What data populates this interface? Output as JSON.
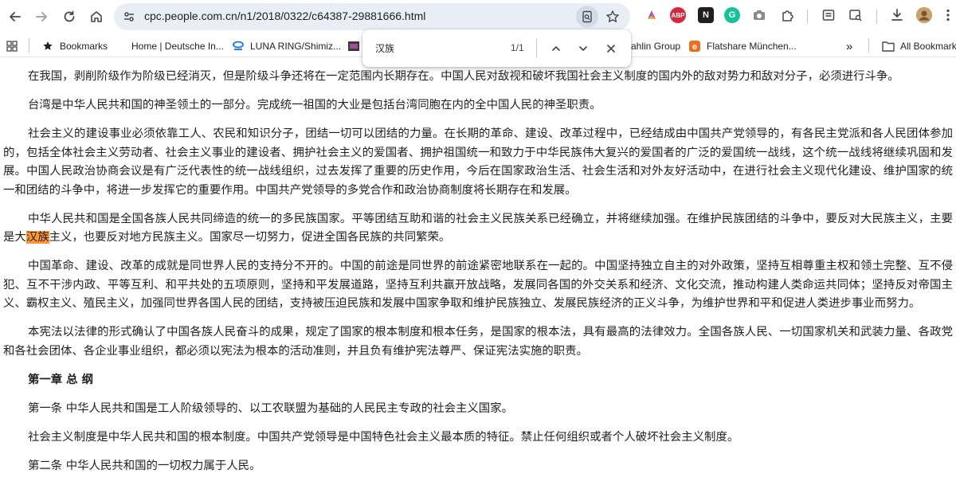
{
  "browser": {
    "url": "cpc.people.com.cn/n1/2018/0322/c64387-29881666.html",
    "extensions": [
      "aurora-icon",
      "abp-icon",
      "notion-icon",
      "grammarly-icon",
      "camera-icon",
      "puzzle-icon"
    ],
    "abp_label": "ABP",
    "notion_label": "N",
    "grammarly_label": "G"
  },
  "bookmarks": {
    "items": [
      {
        "label": "Bookmarks"
      },
      {
        "label": "Home | Deutsche In..."
      },
      {
        "label": "LUNA RING/Shimiz..."
      },
      {
        "label": "ahlin Group"
      },
      {
        "label": "Flatshare München..."
      }
    ],
    "overflow_label": "»",
    "all_bookmarks": "All Bookmarks"
  },
  "find": {
    "query": "汉族",
    "count": "1/1"
  },
  "article": {
    "p1": "在我国，剥削阶级作为阶级已经消灭，但是阶级斗争还将在一定范围内长期存在。中国人民对敌视和破坏我国社会主义制度的国内外的敌对势力和敌对分子，必须进行斗争。",
    "p2": "台湾是中华人民共和国的神圣领土的一部分。完成统一祖国的大业是包括台湾同胞在内的全中国人民的神圣职责。",
    "p3": "社会主义的建设事业必须依靠工人、农民和知识分子，团结一切可以团结的力量。在长期的革命、建设、改革过程中，已经结成由中国共产党领导的，有各民主党派和各人民团体参加的，包括全体社会主义劳动者、社会主义事业的建设者、拥护社会主义的爱国者、拥护祖国统一和致力于中华民族伟大复兴的爱国者的广泛的爱国统一战线，这个统一战线将继续巩固和发展。中国人民政治协商会议是有广泛代表性的统一战线组织，过去发挥了重要的历史作用，今后在国家政治生活、社会生活和对外友好活动中，在进行社会主义现代化建设、维护国家的统一和团结的斗争中，将进一步发挥它的重要作用。中国共产党领导的多党合作和政治协商制度将长期存在和发展。",
    "p4_before": "中华人民共和国是全国各族人民共同缔造的统一的多民族国家。平等团结互助和谐的社会主义民族关系已经确立，并将继续加强。在维护民族团结的斗争中，要反对大民族主义，主要是大",
    "p4_highlight": "汉族",
    "p4_after": "主义，也要反对地方民族主义。国家尽一切努力，促进全国各民族的共同繁荣。",
    "p5": "中国革命、建设、改革的成就是同世界人民的支持分不开的。中国的前途是同世界的前途紧密地联系在一起的。中国坚持独立自主的对外政策，坚持互相尊重主权和领土完整、互不侵犯、互不干涉内政、平等互利、和平共处的五项原则，坚持和平发展道路，坚持互利共赢开放战略，发展同各国的外交关系和经济、文化交流，推动构建人类命运共同体；坚持反对帝国主义、霸权主义、殖民主义，加强同世界各国人民的团结，支持被压迫民族和发展中国家争取和维护民族独立、发展民族经济的正义斗争，为维护世界和平和促进人类进步事业而努力。",
    "p6": "本宪法以法律的形式确认了中国各族人民奋斗的成果，规定了国家的根本制度和根本任务，是国家的根本法，具有最高的法律效力。全国各族人民、一切国家机关和武装力量、各政党和各社会团体、各企业事业组织，都必须以宪法为根本的活动准则，并且负有维护宪法尊严、保证宪法实施的职责。",
    "chapter_title": "第一章 总 纲",
    "p7": "第一条 中华人民共和国是工人阶级领导的、以工农联盟为基础的人民民主专政的社会主义国家。",
    "p8": "社会主义制度是中华人民共和国的根本制度。中国共产党领导是中国特色社会主义最本质的特征。禁止任何组织或者个人破坏社会主义制度。",
    "p9": "第二条 中华人民共和国的一切权力属于人民。"
  },
  "colors": {
    "highlight": "#ff9632",
    "omnibox": "#e9eef6"
  }
}
